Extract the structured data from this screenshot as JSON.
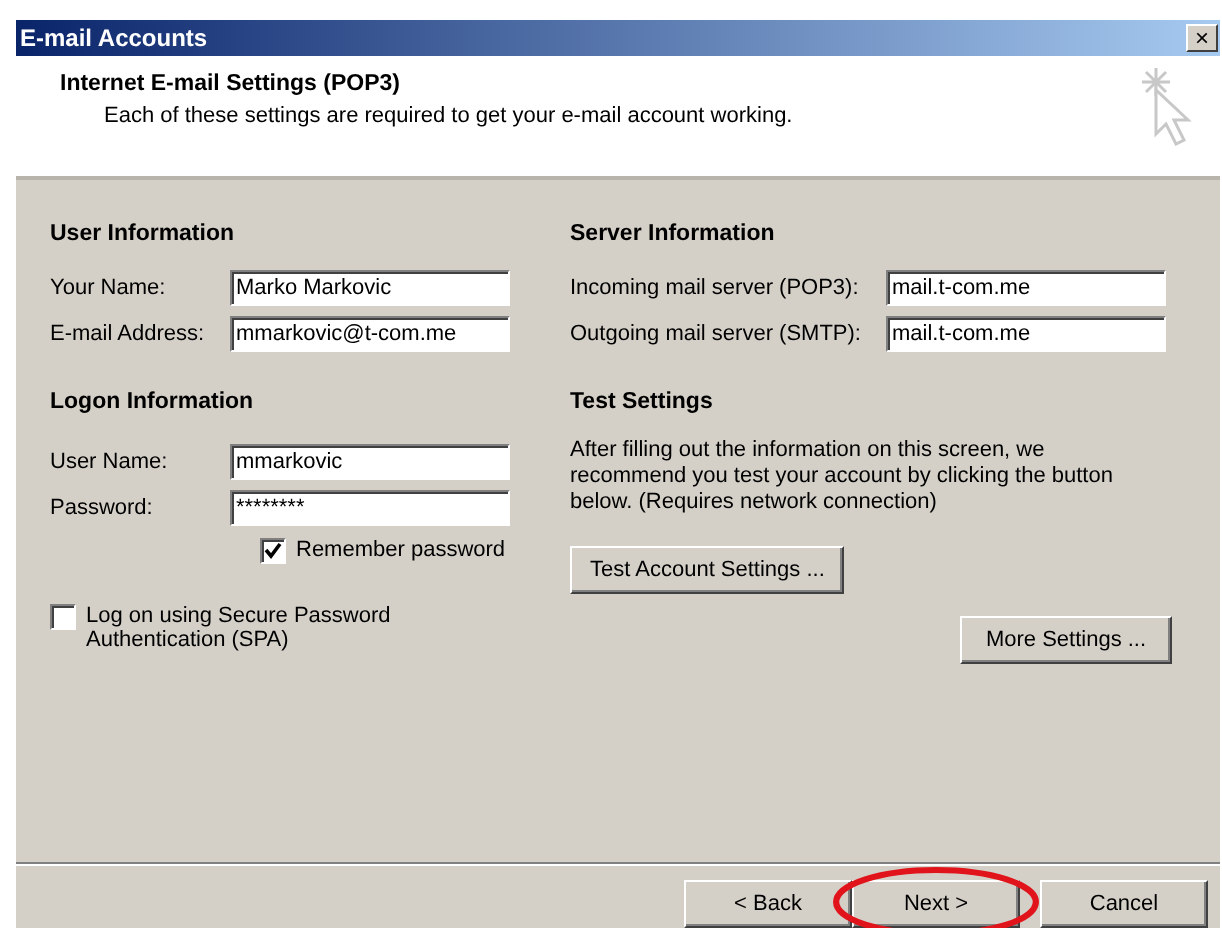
{
  "window": {
    "title": "E-mail Accounts",
    "close": "×"
  },
  "header": {
    "title": "Internet E-mail Settings (POP3)",
    "subtitle": "Each of these settings are required to get your e-mail account working."
  },
  "user_information": {
    "heading": "User Information",
    "fields": [
      {
        "label": "Your Name:",
        "value": "Marko Markovic"
      },
      {
        "label": "E-mail Address:",
        "value": "mmarkovic@t-com.me"
      }
    ]
  },
  "logon_information": {
    "heading": "Logon Information",
    "fields": [
      {
        "label": "User Name:",
        "value": "mmarkovic"
      },
      {
        "label": "Password:",
        "value": "********"
      }
    ],
    "remember_password": {
      "label": "Remember password",
      "checked": true
    },
    "spa": {
      "label": "Log on using Secure Password Authentication (SPA)",
      "checked": false
    }
  },
  "server_information": {
    "heading": "Server Information",
    "fields": [
      {
        "label": "Incoming mail server (POP3):",
        "value": "mail.t-com.me"
      },
      {
        "label": "Outgoing mail server (SMTP):",
        "value": "mail.t-com.me"
      }
    ]
  },
  "test_settings": {
    "heading": "Test Settings",
    "text": "After filling out the information on this screen, we recommend you test your account by clicking the button below. (Requires network connection)",
    "button": "Test Account Settings ..."
  },
  "more_settings_button": "More Settings ...",
  "buttons": [
    {
      "label": "< Back",
      "circled": false
    },
    {
      "label": "Next >",
      "circled": true
    },
    {
      "label": "Cancel",
      "circled": false
    }
  ]
}
